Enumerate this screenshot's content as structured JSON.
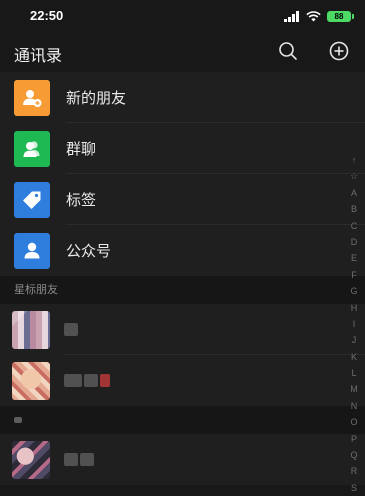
{
  "status_bar": {
    "time": "22:50",
    "battery": "88"
  },
  "header": {
    "title": "通讯录"
  },
  "menu": [
    {
      "label": "新的朋友",
      "icon": "add-friend-icon",
      "color": "#f79c34"
    },
    {
      "label": "群聊",
      "icon": "group-chat-icon",
      "color": "#1fb954"
    },
    {
      "label": "标签",
      "icon": "tag-icon",
      "color": "#2f7ede"
    },
    {
      "label": "公众号",
      "icon": "official-account-icon",
      "color": "#2f7ede"
    }
  ],
  "sections": [
    {
      "title": "星标朋友"
    },
    {
      "title": "A"
    }
  ],
  "index_letters": [
    "↑",
    "☆",
    "A",
    "B",
    "C",
    "D",
    "E",
    "F",
    "G",
    "H",
    "I",
    "J",
    "K",
    "L",
    "M",
    "N",
    "O",
    "P",
    "Q",
    "R",
    "S"
  ]
}
